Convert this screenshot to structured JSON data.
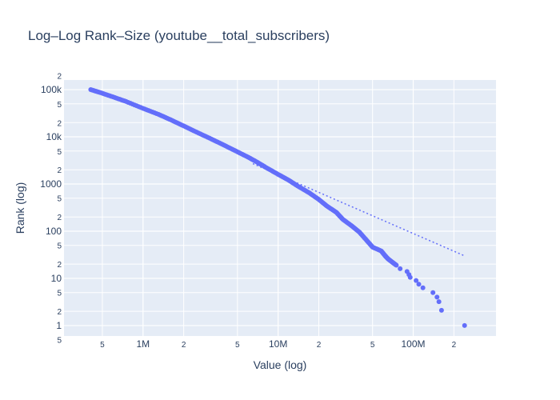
{
  "chart_data": {
    "type": "scatter",
    "title": "Log–Log Rank–Size (youtube__total_subscribers)",
    "xlabel": "Value (log)",
    "ylabel": "Rank (log)",
    "x_scale": "log",
    "y_scale": "log",
    "xlim": [
      260000,
      410000000
    ],
    "ylim": [
      0.6,
      160000
    ],
    "grid": true,
    "legend": "none",
    "colors": {
      "plot_bg": "#e5ecf6",
      "grid": "#ffffff",
      "marker": "#636efa",
      "text": "#2a3f5f"
    },
    "x_ticks": [
      {
        "value": 500000,
        "label": "5",
        "minor": true
      },
      {
        "value": 1000000,
        "label": "1M",
        "minor": false
      },
      {
        "value": 2000000,
        "label": "2",
        "minor": true
      },
      {
        "value": 5000000,
        "label": "5",
        "minor": true
      },
      {
        "value": 10000000,
        "label": "10M",
        "minor": false
      },
      {
        "value": 20000000,
        "label": "2",
        "minor": true
      },
      {
        "value": 50000000,
        "label": "5",
        "minor": true
      },
      {
        "value": 100000000,
        "label": "100M",
        "minor": false
      },
      {
        "value": 200000000,
        "label": "2",
        "minor": true
      }
    ],
    "y_ticks": [
      {
        "value": 0.5,
        "label": "5",
        "minor": true
      },
      {
        "value": 1,
        "label": "1",
        "minor": false
      },
      {
        "value": 2,
        "label": "2",
        "minor": true
      },
      {
        "value": 5,
        "label": "5",
        "minor": true
      },
      {
        "value": 10,
        "label": "10",
        "minor": false
      },
      {
        "value": 20,
        "label": "2",
        "minor": true
      },
      {
        "value": 50,
        "label": "5",
        "minor": true
      },
      {
        "value": 100,
        "label": "100",
        "minor": false
      },
      {
        "value": 200,
        "label": "2",
        "minor": true
      },
      {
        "value": 500,
        "label": "5",
        "minor": true
      },
      {
        "value": 1000,
        "label": "1000",
        "minor": false
      },
      {
        "value": 2000,
        "label": "2",
        "minor": true
      },
      {
        "value": 5000,
        "label": "5",
        "minor": true
      },
      {
        "value": 10000,
        "label": "10k",
        "minor": false
      },
      {
        "value": 20000,
        "label": "2",
        "minor": true
      },
      {
        "value": 50000,
        "label": "5",
        "minor": true
      },
      {
        "value": 100000,
        "label": "100k",
        "minor": false
      },
      {
        "value": 200000,
        "label": "2",
        "minor": true
      }
    ],
    "series": [
      {
        "kind": "markers",
        "points": [
          [
            410000,
            100000
          ],
          [
            480000,
            87000
          ],
          [
            600000,
            70000
          ],
          [
            750000,
            56000
          ],
          [
            1000000,
            40000
          ],
          [
            1300000,
            30000
          ],
          [
            1600000,
            23000
          ],
          [
            2000000,
            17000
          ],
          [
            2500000,
            12500
          ],
          [
            3200000,
            9000
          ],
          [
            4000000,
            6600
          ],
          [
            5000000,
            4800
          ],
          [
            6000000,
            3700
          ],
          [
            7000000,
            2900
          ],
          [
            8000000,
            2300
          ],
          [
            10000000,
            1600
          ],
          [
            12000000,
            1200
          ],
          [
            14000000,
            900
          ],
          [
            17000000,
            650
          ],
          [
            20000000,
            470
          ],
          [
            23000000,
            340
          ],
          [
            27000000,
            250
          ],
          [
            30000000,
            180
          ],
          [
            35000000,
            130
          ],
          [
            40000000,
            95
          ],
          [
            45000000,
            65
          ],
          [
            50000000,
            46
          ],
          [
            58000000,
            38
          ],
          [
            62000000,
            30
          ],
          [
            65000000,
            26
          ],
          [
            70000000,
            22
          ],
          [
            75000000,
            19
          ],
          [
            80000000,
            16
          ],
          [
            90000000,
            14
          ],
          [
            93000000,
            12
          ],
          [
            95000000,
            10.5
          ],
          [
            105000000,
            9
          ],
          [
            110000000,
            7.5
          ],
          [
            118000000,
            6.3
          ],
          [
            140000000,
            5
          ],
          [
            150000000,
            4
          ],
          [
            155000000,
            3.2
          ],
          [
            162000000,
            2.1
          ],
          [
            240000000,
            1
          ]
        ]
      },
      {
        "kind": "dotted-line",
        "points": [
          [
            6500000,
            2700
          ],
          [
            240000000,
            30
          ]
        ]
      }
    ]
  }
}
